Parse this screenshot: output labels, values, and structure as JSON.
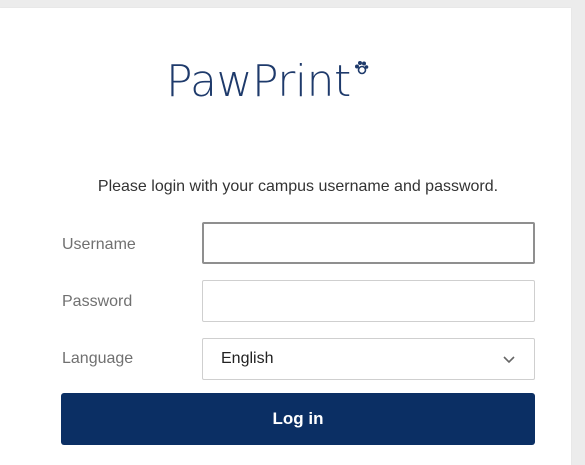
{
  "brand": {
    "name": "PawPrint",
    "text_color": "#1e3a6b"
  },
  "instructions": "Please login with your campus username and password.",
  "form": {
    "username": {
      "label": "Username",
      "value": "",
      "placeholder": ""
    },
    "password": {
      "label": "Password",
      "value": "",
      "placeholder": ""
    },
    "language": {
      "label": "Language",
      "selected": "English"
    },
    "submit_label": "Log in"
  },
  "colors": {
    "primary_button": "#0b2f64",
    "page_background": "#ececec"
  },
  "icons": {
    "paw": "paw-icon",
    "select_arrow": "chevron-down-icon"
  }
}
